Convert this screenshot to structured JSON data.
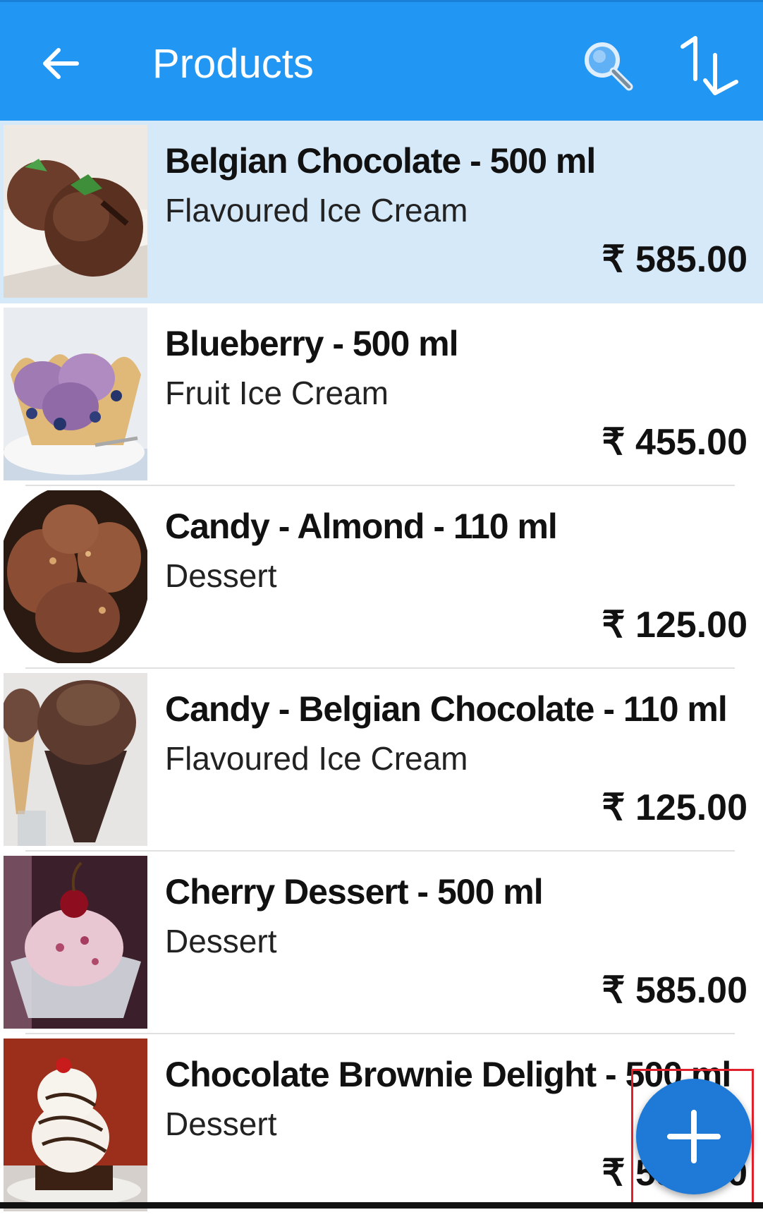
{
  "appbar": {
    "title": "Products",
    "back_icon": "arrow-left-icon",
    "search_icon": "search-icon",
    "sort_icon": "sort-icon",
    "color": "#2196f3"
  },
  "products": [
    {
      "name": "Belgian Chocolate - 500 ml",
      "category": "Flavoured Ice Cream",
      "price": "₹ 585.00",
      "selected": true
    },
    {
      "name": "Blueberry - 500 ml",
      "category": "Fruit Ice Cream",
      "price": "₹ 455.00"
    },
    {
      "name": "Candy - Almond - 110 ml",
      "category": "Dessert",
      "price": "₹ 125.00"
    },
    {
      "name": "Candy - Belgian Chocolate - 110 ml",
      "category": "Flavoured Ice Cream",
      "price": "₹ 125.00"
    },
    {
      "name": "Cherry Dessert - 500 ml",
      "category": "Dessert",
      "price": "₹ 585.00"
    },
    {
      "name": "Chocolate Brownie Delight - 500 ml",
      "category": "Dessert",
      "price": "₹ 585.00"
    }
  ],
  "fab": {
    "icon": "plus-icon",
    "color": "#1e7ad6"
  },
  "selection_color": "#d6e9f9"
}
